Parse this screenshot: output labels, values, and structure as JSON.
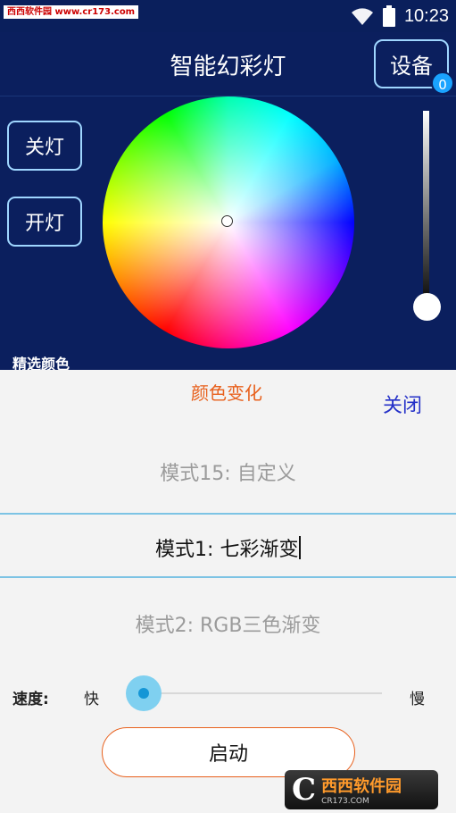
{
  "watermark_top": "西西软件园 www.cr173.com",
  "status_bar": {
    "time": "10:23"
  },
  "header": {
    "title": "智能幻彩灯",
    "device_button": "设备",
    "device_count": "0"
  },
  "controls": {
    "off_button": "关灯",
    "on_button": "开灯",
    "featured_colors_label": "精选颜色",
    "brightness_level": 0.1
  },
  "sheet": {
    "title": "颜色变化",
    "close_label": "关闭",
    "modes": [
      {
        "label": "模式15: 自定义",
        "selected": false
      },
      {
        "label": "模式1: 七彩渐变",
        "selected": true
      },
      {
        "label": "模式2: RGB三色渐变",
        "selected": false
      }
    ],
    "speed_label": "速度:",
    "speed_fast": "快",
    "speed_slow": "慢",
    "speed_value": 0.0,
    "start_button": "启动"
  },
  "watermark_br": {
    "brand": "西西软件园",
    "url": "CR173.COM"
  },
  "colors": {
    "background": "#0b1f5e",
    "accent_border": "#9fd6ff",
    "sheet_title": "#e8601c",
    "close_link": "#2430c8",
    "selected_line": "#7cc3e4",
    "badge": "#1aa3ff"
  }
}
